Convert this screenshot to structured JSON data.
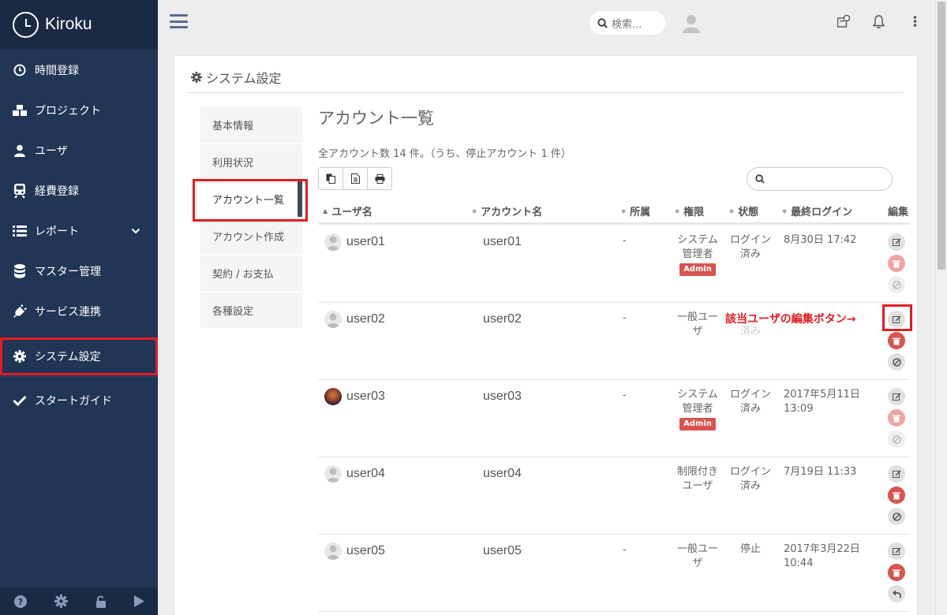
{
  "app": {
    "name": "Kiroku"
  },
  "sidebar": {
    "items": [
      {
        "label": "時間登録",
        "icon": "clock-icon"
      },
      {
        "label": "プロジェクト",
        "icon": "cubes-icon"
      },
      {
        "label": "ユーザ",
        "icon": "user-icon"
      },
      {
        "label": "経費登録",
        "icon": "train-icon"
      },
      {
        "label": "レポート",
        "icon": "list-icon"
      },
      {
        "label": "マスター管理",
        "icon": "database-icon"
      },
      {
        "label": "サービス連携",
        "icon": "plug-icon"
      },
      {
        "label": "システム設定",
        "icon": "gear-icon"
      },
      {
        "label": "スタートガイド",
        "icon": "check-icon"
      }
    ],
    "bottom_icons": [
      "help-icon",
      "settings-icon",
      "unlock-icon",
      "play-icon"
    ]
  },
  "topbar": {
    "search_placeholder": "検索..."
  },
  "card": {
    "title": "システム設定"
  },
  "submenu": {
    "items": [
      "基本情報",
      "利用状況",
      "アカウント一覧",
      "アカウント作成",
      "契約 / お支払",
      "各種設定"
    ],
    "active_index": 2
  },
  "accounts": {
    "title": "アカウント一覧",
    "summary": "全アカウント数 14 件。（うち、停止アカウント 1 件）",
    "columns": [
      "ユーザ名",
      "アカウント名",
      "所属",
      "権限",
      "状態",
      "最終ログイン",
      "編集"
    ],
    "rows": [
      {
        "user": "user01",
        "account": "user01",
        "dept": "-",
        "role": "システム 管理者",
        "admin": "Admin",
        "status": "ログイン 済み",
        "last_login": "8月30日 17:42"
      },
      {
        "user": "user02",
        "account": "user02",
        "dept": "-",
        "role": "一般ユー ザ",
        "admin": "",
        "status": "済み",
        "last_login": ""
      },
      {
        "user": "user03",
        "account": "user03",
        "dept": "-",
        "role": "システム 管理者",
        "admin": "Admin",
        "status": "ログイン 済み",
        "last_login": "2017年5月11日 13:09"
      },
      {
        "user": "user04",
        "account": "user04",
        "dept": "",
        "role": "制限付き ユーザ",
        "admin": "",
        "status": "ログイン 済み",
        "last_login": "7月19日 11:33"
      },
      {
        "user": "user05",
        "account": "user05",
        "dept": "-",
        "role": "一般ユー ザ",
        "admin": "",
        "status": "停止",
        "last_login": "2017年3月22日 10:44"
      }
    ],
    "annotation": "該当ユーザの編集ボタン→"
  }
}
